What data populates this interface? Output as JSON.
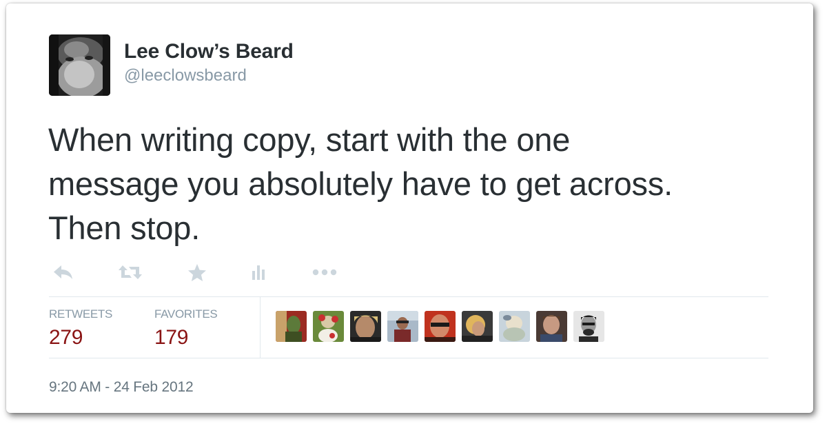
{
  "user": {
    "display_name": "Lee Clow’s Beard",
    "screen_name": "@leeclowsbeard"
  },
  "tweet": {
    "line1": "When writing copy, start with the one",
    "line2": "message you absolutely have to get across.",
    "line3": "Then stop.",
    "timestamp": "9:20 AM - 24 Feb 2012"
  },
  "actions": [
    {
      "name": "reply",
      "icon": "reply-icon"
    },
    {
      "name": "retweet",
      "icon": "retweet-icon"
    },
    {
      "name": "favorite",
      "icon": "star-icon"
    },
    {
      "name": "stats",
      "icon": "bar-chart-icon"
    },
    {
      "name": "more",
      "icon": "ellipsis-icon"
    }
  ],
  "stats": {
    "retweets_label": "RETWEETS",
    "retweets_count": "279",
    "favorites_label": "FAVORITES",
    "favorites_count": "179"
  },
  "favoriters_count_shown": 9,
  "colors": {
    "name": "#292f33",
    "muted": "#8899a6",
    "count": "#8a1414",
    "icon": "#ccd6dd",
    "border": "#e1e8ed"
  }
}
